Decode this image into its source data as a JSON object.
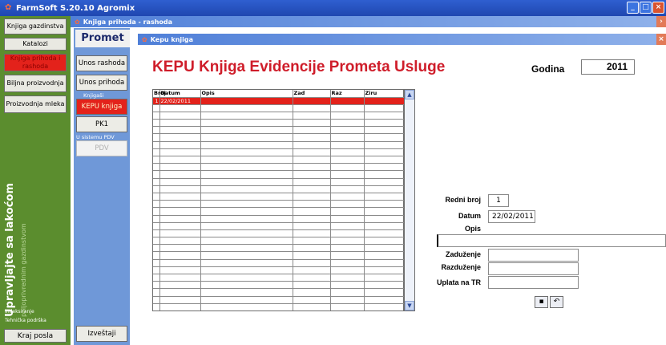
{
  "window": {
    "title": "FarmSoft S.20.10 Agromix"
  },
  "subwindow": {
    "title": "Knjiga prihoda - rashoda"
  },
  "innerwindow": {
    "title": "Kepu knjiga"
  },
  "sidebar": {
    "items": [
      {
        "label": "Knjiga gazdinstva"
      },
      {
        "label": "Katalozi"
      },
      {
        "label": "Knjiga prihoda i rashoda"
      },
      {
        "label": "Biljna proizvodnja"
      },
      {
        "label": "Proizvodnja mleka"
      }
    ],
    "tagline_big": "Upravljajte sa lakoćom",
    "tagline_small": "poljoprivrednim gazdinstvom",
    "link1": "Indeksiranje",
    "link2": "Tehnička podrška",
    "exit_label": "Kraj posla"
  },
  "promet": {
    "title": "Promet",
    "unos_rashoda": "Unos rashoda",
    "unos_prihoda": "Unos prihoda",
    "group_knjige": "Knjigaši",
    "kepu": "KEPU knjiga",
    "pk1": "PK1",
    "group_pdv": "U sistemu PDV",
    "pdv": "PDV",
    "izvestaji": "Izveštaji"
  },
  "main": {
    "title": "KEPU Knjiga Evidencije Prometa Usluge",
    "godina_label": "Godina",
    "godina_value": "2011"
  },
  "grid": {
    "columns": [
      "Broj",
      "Datum",
      "Opis",
      "Zad",
      "Raz",
      "Ziru"
    ],
    "rows": [
      {
        "broj": "1",
        "datum": "22/02/2011",
        "opis": "",
        "zad": "",
        "raz": "",
        "ziru": ""
      }
    ],
    "empty_rows": 28
  },
  "form": {
    "redni_broj_label": "Redni broj",
    "redni_broj_value": "1",
    "datum_label": "Datum",
    "datum_value": "22/02/2011",
    "opis_label": "Opis",
    "opis_value": "",
    "zaduzenje_label": "Zaduženje",
    "zaduzenje_value": "",
    "razduzenje_label": "Razduženje",
    "razduzenje_value": "",
    "uplata_label": "Uplata na TR",
    "uplata_value": "",
    "save_icon": "save-icon",
    "undo_icon": "undo-icon"
  }
}
